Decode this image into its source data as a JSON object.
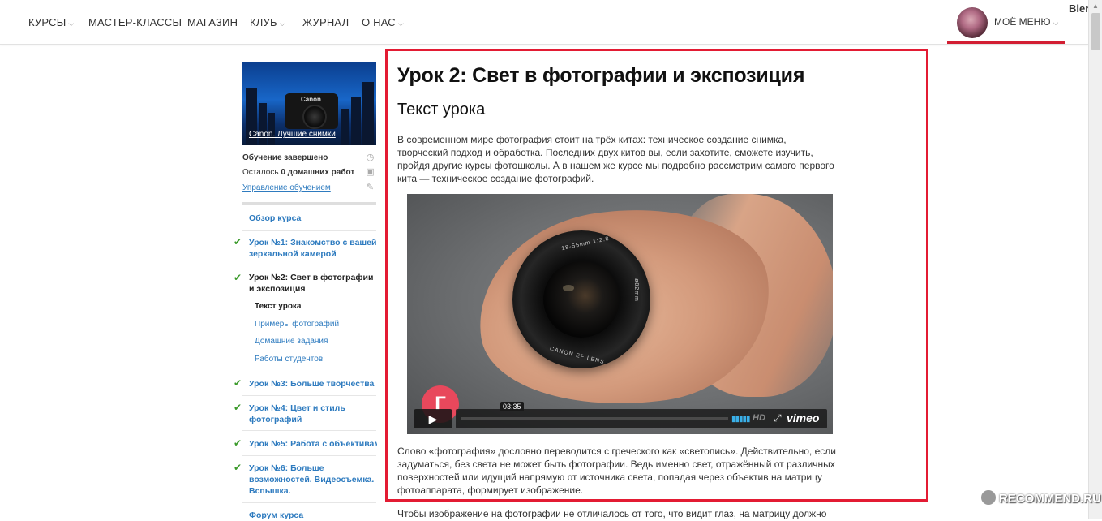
{
  "nav": {
    "items": [
      {
        "label": "КУРСЫ",
        "dropdown": true
      },
      {
        "label": "МАСТЕР-КЛАССЫ",
        "dropdown": false
      },
      {
        "label": "МАГАЗИН",
        "dropdown": false
      },
      {
        "label": "КЛУБ",
        "dropdown": true
      },
      {
        "label": "ЖУРНАЛ",
        "dropdown": false
      },
      {
        "label": "О НАС",
        "dropdown": true
      }
    ],
    "my_menu": "МОЁ МЕНЮ",
    "username": "Blerry",
    "accent_color": "#d21e32"
  },
  "sidebar": {
    "course_thumb_brand": "Canon",
    "course_caption": "Canon. Лучшие снимки",
    "status": "Обучение завершено",
    "remaining_prefix": "Осталось ",
    "remaining_count": "0 домашних работ",
    "manage_link": "Управление обучением",
    "lessons": [
      {
        "label": "Обзор курса",
        "done": false
      },
      {
        "label": "Урок №1: Знакомство с вашей зеркальной камерой",
        "done": true
      },
      {
        "label": "Урок №2: Свет в фотографии и экспозиция",
        "done": true,
        "active": true
      },
      {
        "label": "Урок №3: Больше творчества",
        "done": true
      },
      {
        "label": "Урок №4: Цвет и стиль фотографий",
        "done": true
      },
      {
        "label": "Урок №5: Работа с объективами",
        "done": true
      },
      {
        "label": "Урок №6: Больше возможностей. Видеосъемка. Вспышка.",
        "done": true
      },
      {
        "label": "Форум курса",
        "done": false
      }
    ],
    "sublessons": [
      {
        "label": "Текст урока",
        "active": true
      },
      {
        "label": "Примеры фотографий"
      },
      {
        "label": "Домашние задания"
      },
      {
        "label": "Работы студентов"
      }
    ]
  },
  "main": {
    "title": "Урок 2: Свет в фотографии и экспозиция",
    "section_title": "Текст урока",
    "paragraph1": [
      "В современном мире фотография стоит на трёх китах: техническое создание снимка,",
      "творческий подход и обработка. Последних двух китов вы, если захотите, сможете изучить,",
      "пройдя другие курсы фотошколы. А в нашем же курсе мы подробно рассмотрим самого первого",
      "кита — техническое создание фотографий."
    ],
    "paragraph2": [
      "Слово «фотография» дословно переводится с греческого как «светопись». Действительно, если",
      "задуматься, без света не может быть фотографии. Ведь именно свет, отражённый от различных",
      "поверхностей или идущий напрямую от источника света, попадая через объектив на матрицу",
      "фотоаппарата, формирует изображение."
    ],
    "paragraph3_partial": "Чтобы изображение на фотографии не отличалось от того, что видит глаз, на матрицу должно",
    "frame_color": "#e31b33"
  },
  "video": {
    "duration": "03:35",
    "hd_label": "HD",
    "provider": "vimeo",
    "lens_text_top": "18-55mm 1:2.8",
    "lens_text_bottom": "CANON EF LENS",
    "lens_text_side": "ø82mm"
  },
  "watermark": "RECOMMEND.RU"
}
